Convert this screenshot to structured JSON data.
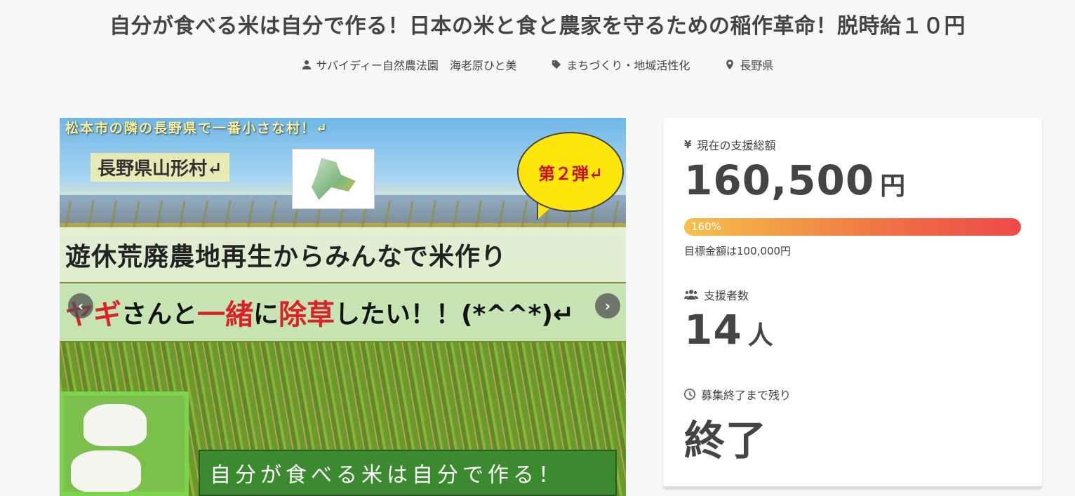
{
  "page": {
    "title": "自分が食べる米は自分で作る！日本の米と食と農家を守るための稲作革命！脱時給１０円"
  },
  "meta": {
    "owner": "サバイディー自然農法園　海老原ひと美",
    "category": "まちづくり・地域活性化",
    "location": "長野県",
    "owner_icon": "user-icon",
    "category_icon": "tag-icon",
    "location_icon": "map-pin-icon"
  },
  "hero": {
    "top_banner": "松本市の隣の長野県で一番小さな村！↵",
    "village": "長野県山形村↵",
    "bubble": "第２弾↵",
    "strip1": "遊休荒廃農地再生からみんなで米作り",
    "strip2_parts": [
      "ヤギ",
      "さんと",
      "一緒",
      "に",
      "除草",
      "したい！！(*^^*)↵"
    ],
    "slogan": "自分が食べる米は自分で作る！",
    "prev_icon": "chevron-left-icon",
    "next_icon": "chevron-right-icon",
    "prev_glyph": "‹",
    "next_glyph": "›"
  },
  "stats": {
    "total_label": "現在の支援総額",
    "total_value": "160,500",
    "total_unit": "円",
    "total_icon": "yen-icon",
    "progress_percent": 160,
    "progress_label": "160%",
    "goal_text": "目標金額は100,000円",
    "backers_label": "支援者数",
    "backers_value": "14",
    "backers_unit": "人",
    "backers_icon": "users-icon",
    "remaining_label": "募集終了まで残り",
    "remaining_value": "終了",
    "remaining_icon": "clock-icon"
  },
  "colors": {
    "accent_gradient_start": "#f6c04a",
    "accent_gradient_end": "#ee4a48",
    "bubble": "#ffe60a",
    "highlight_red": "#d8232a"
  }
}
